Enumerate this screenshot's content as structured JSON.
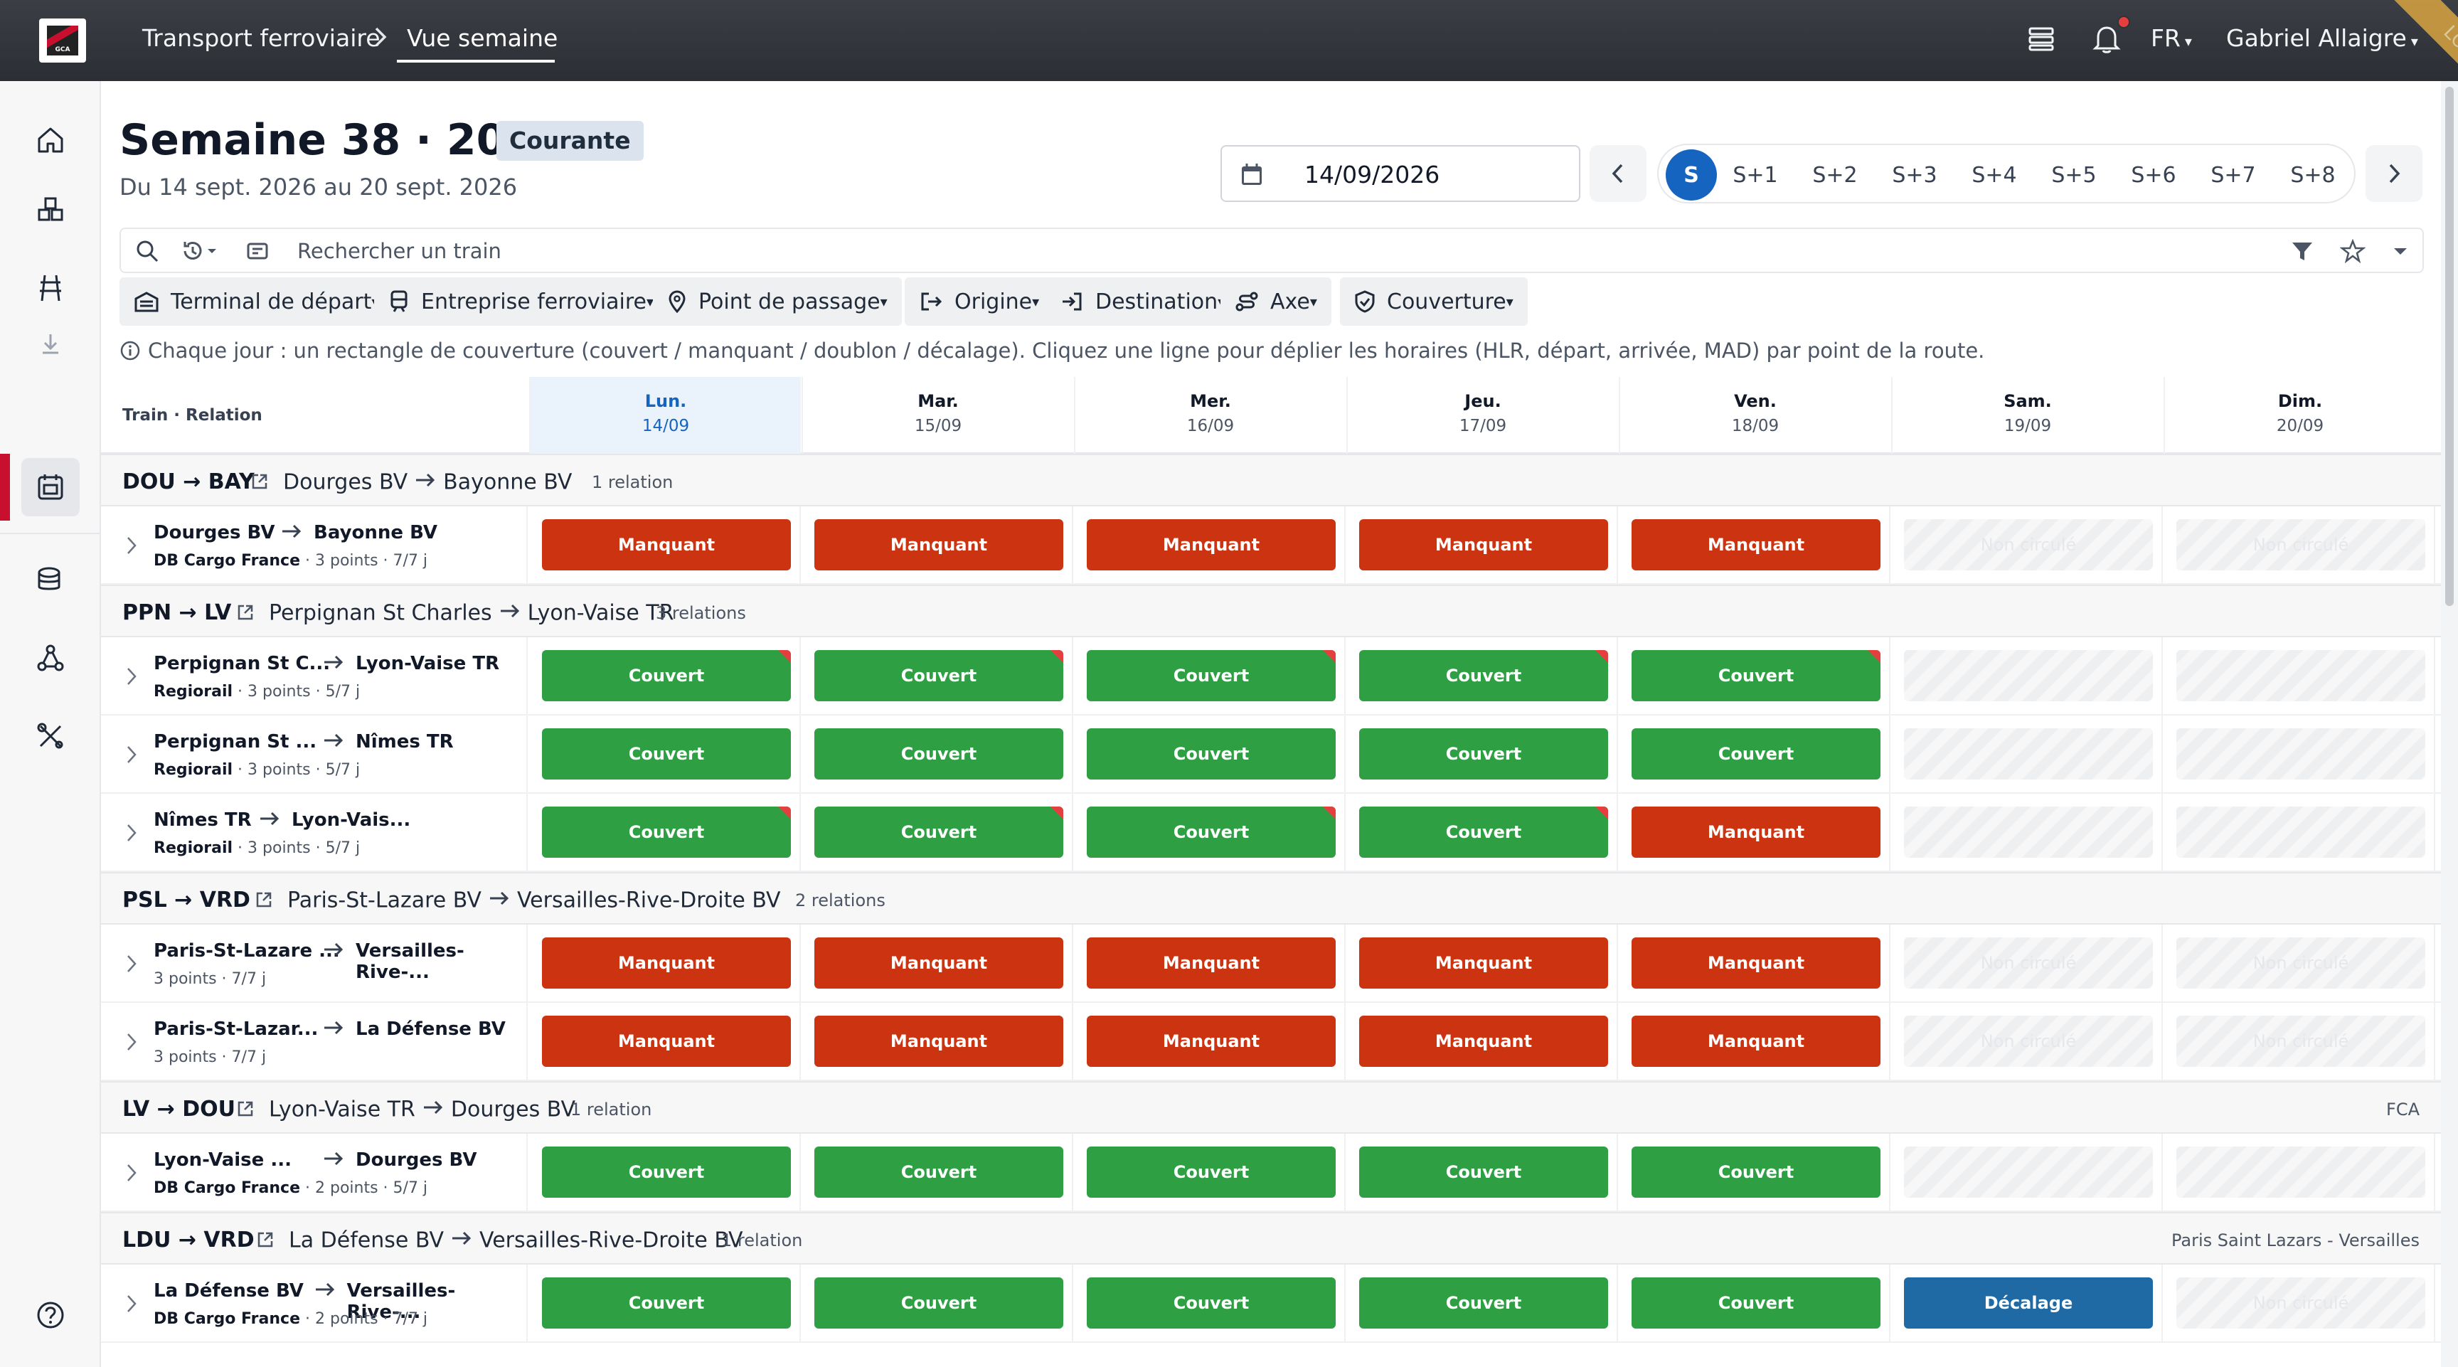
{
  "topbar": {
    "breadcrumb": [
      "Transport ferroviaire",
      "Vue semaine"
    ],
    "language": "FR",
    "user": "Gabriel Allaigre",
    "ribbon": "LOCAL",
    "logo_text": "GCA"
  },
  "header": {
    "title": "Semaine 38 · 2026",
    "badge": "Courante",
    "subtitle": "Du 14 sept. 2026 au 20 sept. 2026",
    "date_value": "14/09/2026",
    "weeks": [
      "S",
      "S+1",
      "S+2",
      "S+3",
      "S+4",
      "S+5",
      "S+6",
      "S+7",
      "S+8"
    ]
  },
  "search": {
    "placeholder": "Rechercher un train"
  },
  "filters": [
    "Terminal de départ",
    "Entreprise ferroviaire",
    "Point de passage",
    "Origine",
    "Destination",
    "Axe",
    "Couverture"
  ],
  "info": "Chaque jour : un rectangle de couverture (couvert / manquant / doublon / décalage). Cliquez une ligne pour déplier les horaires (HLR, départ, arrivée, MAD) par point de la route.",
  "grid": {
    "first_header": "Train · Relation",
    "days": [
      {
        "day": "Lun.",
        "date": "14/09"
      },
      {
        "day": "Mar.",
        "date": "15/09"
      },
      {
        "day": "Mer.",
        "date": "16/09"
      },
      {
        "day": "Jeu.",
        "date": "17/09"
      },
      {
        "day": "Ven.",
        "date": "18/09"
      },
      {
        "day": "Sam.",
        "date": "19/09"
      },
      {
        "day": "Dim.",
        "date": "20/09"
      }
    ],
    "groups": [
      {
        "code": "DOU → BAY",
        "from": "Dourges BV",
        "to": "Bayonne BV",
        "count": "1 relation",
        "right": ""
      },
      {
        "code": "PPN → LV",
        "from": "Perpignan St Charles",
        "to": "Lyon-Vaise TR",
        "count": "3 relations",
        "right": ""
      },
      {
        "code": "PSL → VRD",
        "from": "Paris-St-Lazare BV",
        "to": "Versailles-Rive-Droite BV",
        "count": "2 relations",
        "right": ""
      },
      {
        "code": "LV → DOU",
        "from": "Lyon-Vaise TR",
        "to": "Dourges BV",
        "count": "1 relation",
        "right": "FCA"
      },
      {
        "code": "LDU → VRD",
        "from": "La Défense BV",
        "to": "Versailles-Rive-Droite BV",
        "count": "1 relation",
        "right": "Paris Saint Lazars - Versailles"
      }
    ],
    "rows": [
      {
        "from": "Dourges BV",
        "to": "Bayonne BV",
        "company": "DB Cargo France",
        "points": "3 points",
        "days": "7/7 j",
        "cells": [
          "Manquant",
          "Manquant",
          "Manquant",
          "Manquant",
          "Manquant",
          "Non circulé",
          "Non circulé"
        ],
        "flags": [
          0,
          0,
          0,
          0,
          0,
          0,
          0
        ]
      },
      {
        "from": "Perpignan St C...",
        "to": "Lyon-Vaise TR",
        "company": "Regiorail",
        "points": "3 points",
        "days": "5/7 j",
        "cells": [
          "Couvert",
          "Couvert",
          "Couvert",
          "Couvert",
          "Couvert",
          "",
          ""
        ],
        "flags": [
          1,
          1,
          1,
          1,
          1,
          0,
          0
        ]
      },
      {
        "from": "Perpignan St ...",
        "to": "Nîmes TR",
        "company": "Regiorail",
        "points": "3 points",
        "days": "5/7 j",
        "cells": [
          "Couvert",
          "Couvert",
          "Couvert",
          "Couvert",
          "Couvert",
          "",
          ""
        ],
        "flags": [
          0,
          0,
          0,
          0,
          0,
          0,
          0
        ]
      },
      {
        "from": "Nîmes TR",
        "to": "Lyon-Vais...",
        "company": "Regiorail",
        "points": "3 points",
        "days": "5/7 j",
        "cells": [
          "Couvert",
          "Couvert",
          "Couvert",
          "Couvert",
          "Manquant",
          "",
          ""
        ],
        "flags": [
          1,
          1,
          1,
          1,
          0,
          0,
          0
        ]
      },
      {
        "from": "Paris-St-Lazare ...",
        "to": "Versailles-Rive-...",
        "company": "",
        "points": "3 points",
        "days": "7/7 j",
        "cells": [
          "Manquant",
          "Manquant",
          "Manquant",
          "Manquant",
          "Manquant",
          "Non circulé",
          "Non circulé"
        ],
        "flags": [
          0,
          0,
          0,
          0,
          0,
          0,
          0
        ]
      },
      {
        "from": "Paris-St-Lazar...",
        "to": "La Défense BV",
        "company": "",
        "points": "3 points",
        "days": "7/7 j",
        "cells": [
          "Manquant",
          "Manquant",
          "Manquant",
          "Manquant",
          "Manquant",
          "Non circulé",
          "Non circulé"
        ],
        "flags": [
          0,
          0,
          0,
          0,
          0,
          0,
          0
        ]
      },
      {
        "from": "Lyon-Vaise ...",
        "to": "Dourges BV",
        "company": "DB Cargo France",
        "points": "2 points",
        "days": "5/7 j",
        "cells": [
          "Couvert",
          "Couvert",
          "Couvert",
          "Couvert",
          "Couvert",
          "",
          ""
        ],
        "flags": [
          0,
          0,
          0,
          0,
          0,
          0,
          0
        ]
      },
      {
        "from": "La Défense BV",
        "to": "Versailles-Rive-...",
        "company": "DB Cargo France",
        "points": "2 points",
        "days": "7/7 j",
        "cells": [
          "Couvert",
          "Couvert",
          "Couvert",
          "Couvert",
          "Couvert",
          "Décalage",
          "Non circulé"
        ],
        "flags": [
          0,
          0,
          0,
          0,
          0,
          0,
          0
        ]
      }
    ]
  },
  "colors": {
    "manquant": "#cc3310",
    "couvert": "#2ea043",
    "decalage": "#1f6aa5",
    "accent": "#1565c0",
    "brand": "#c8102e"
  }
}
